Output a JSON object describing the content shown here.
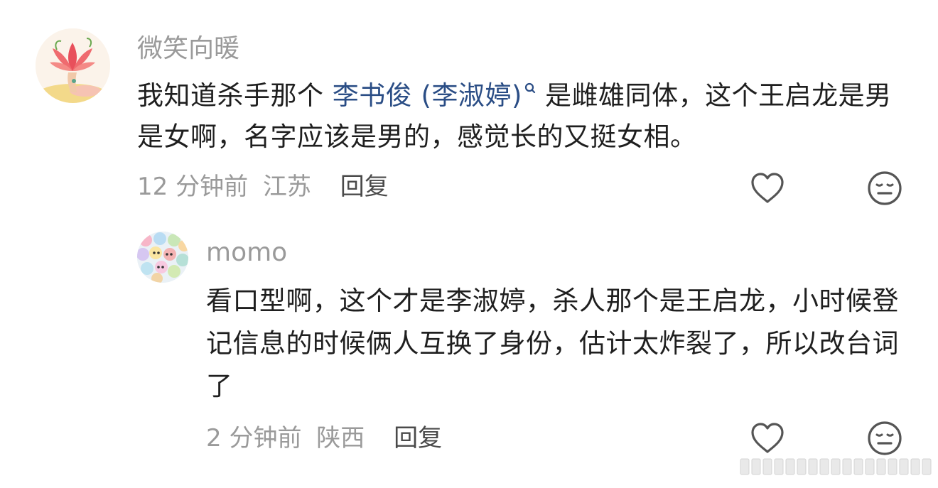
{
  "comments": [
    {
      "username": "微笑向暖",
      "body": {
        "before": "我知道杀手那个 ",
        "link": "李书俊 (李淑婷)",
        "after": " 是雌雄同体，这个王启龙是男是女啊，名字应该是男的，感觉长的又挺女相。"
      },
      "time": "12 分钟前",
      "location": "江苏",
      "reply_label": "回复",
      "like_icon": "heart-outline-icon",
      "dislike_icon": "meh-face-icon"
    },
    {
      "username": "momo",
      "body": "看口型啊，这个才是李淑婷，杀人那个是王启龙，小时候登记信息的时候俩人互换了身份，估计太炸裂了，所以改台词了",
      "time": "2 分钟前",
      "location": "陕西",
      "reply_label": "回复",
      "like_icon": "heart-outline-icon",
      "dislike_icon": "meh-face-icon"
    }
  ],
  "colors": {
    "text": "#1f1f1f",
    "meta": "#9a9a9a",
    "link": "#2a4d85",
    "icon": "#555555"
  }
}
